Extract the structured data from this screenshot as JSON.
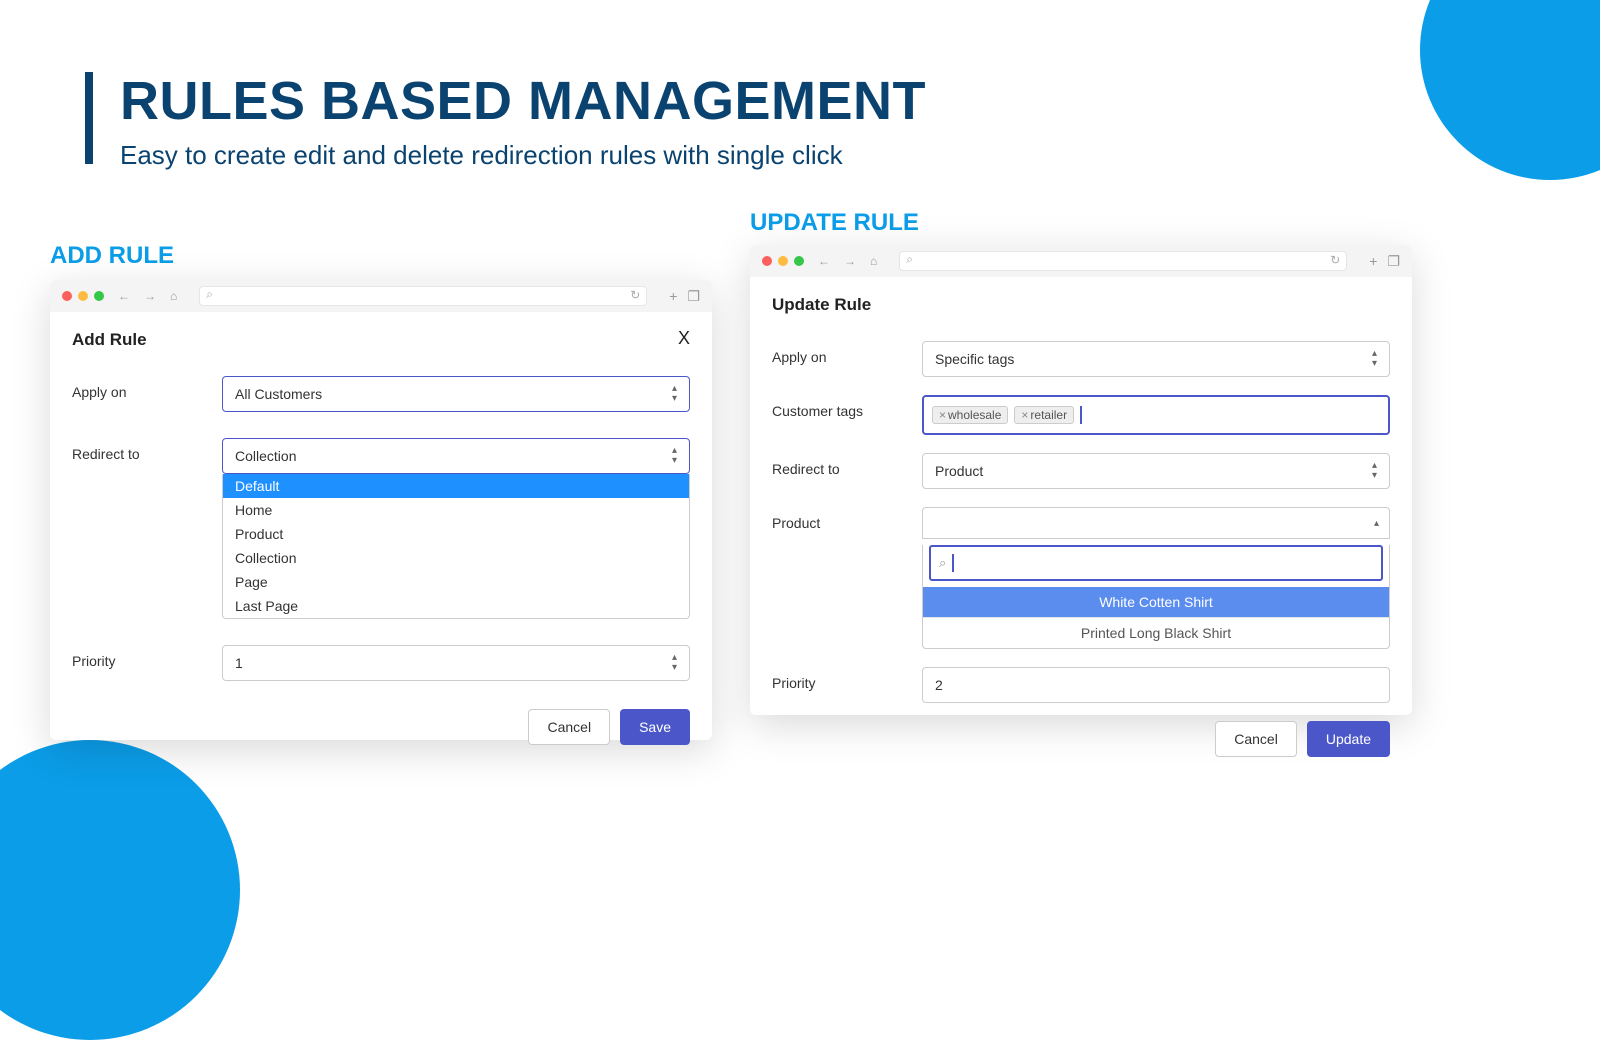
{
  "header": {
    "title": "RULES BASED MANAGEMENT",
    "subtitle": "Easy to create edit and delete redirection rules with single click"
  },
  "left": {
    "section_label": "ADD RULE",
    "modal_title": "Add Rule",
    "apply_on_label": "Apply on",
    "apply_on_value": "All Customers",
    "redirect_to_label": "Redirect to",
    "redirect_to_value": "Collection",
    "options": [
      "Default",
      "Home",
      "Product",
      "Collection",
      "Page",
      "Last Page"
    ],
    "priority_label": "Priority",
    "priority_value": "1",
    "cancel": "Cancel",
    "save": "Save"
  },
  "right": {
    "section_label": "UPDATE RULE",
    "modal_title": "Update Rule",
    "apply_on_label": "Apply on",
    "apply_on_value": "Specific tags",
    "customer_tags_label": "Customer tags",
    "tags": [
      "wholesale",
      "retailer"
    ],
    "redirect_to_label": "Redirect to",
    "redirect_to_value": "Product",
    "product_label": "Product",
    "product_options": [
      "White Cotten Shirt",
      "Printed Long Black Shirt"
    ],
    "priority_label": "Priority",
    "priority_value": "2",
    "cancel": "Cancel",
    "update": "Update"
  }
}
